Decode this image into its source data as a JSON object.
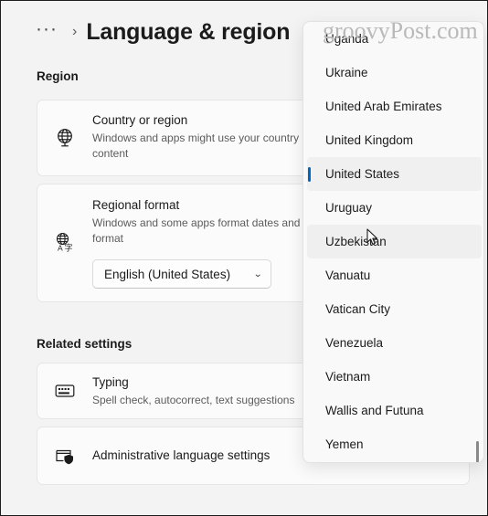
{
  "window": {
    "background_color": "#f3f3f3",
    "accent_color": "#0067c0"
  },
  "header": {
    "breadcrumb_overflow": "···",
    "breadcrumb_separator": "›",
    "title": "Language & region"
  },
  "sections": [
    {
      "label": "Region"
    },
    {
      "label": "Related settings"
    }
  ],
  "region_section": {
    "label": "Region",
    "cards": [
      {
        "icon": "globe-icon",
        "title": "Country or region",
        "subtitle": "Windows and apps might use your country or region to give you local content"
      },
      {
        "icon": "translate-globe-icon",
        "title": "Regional format",
        "subtitle": "Windows and some apps format dates and times based on your regional format",
        "combo_value": "English (United States)",
        "combo_chevron": "⌄"
      }
    ]
  },
  "related_section": {
    "label": "Related settings",
    "cards": [
      {
        "icon": "keyboard-icon",
        "title": "Typing",
        "subtitle": "Spell check, autocorrect, text suggestions"
      },
      {
        "icon": "window-shield-icon",
        "title": "Administrative language settings",
        "subtitle": ""
      }
    ]
  },
  "dropdown": {
    "selected": "United States",
    "hovered": "Uzbekistan",
    "items": [
      {
        "label": "Uganda",
        "state": "normal"
      },
      {
        "label": "Ukraine",
        "state": "normal"
      },
      {
        "label": "United Arab Emirates",
        "state": "normal"
      },
      {
        "label": "United Kingdom",
        "state": "normal"
      },
      {
        "label": "United States",
        "state": "selected"
      },
      {
        "label": "Uruguay",
        "state": "normal"
      },
      {
        "label": "Uzbekistan",
        "state": "hover"
      },
      {
        "label": "Vanuatu",
        "state": "normal"
      },
      {
        "label": "Vatican City",
        "state": "normal"
      },
      {
        "label": "Venezuela",
        "state": "normal"
      },
      {
        "label": "Vietnam",
        "state": "normal"
      },
      {
        "label": "Wallis and Futuna",
        "state": "normal"
      },
      {
        "label": "Yemen",
        "state": "normal"
      }
    ]
  },
  "watermark": {
    "text": "groovyPost.com",
    "color": "#b9b9b9"
  }
}
